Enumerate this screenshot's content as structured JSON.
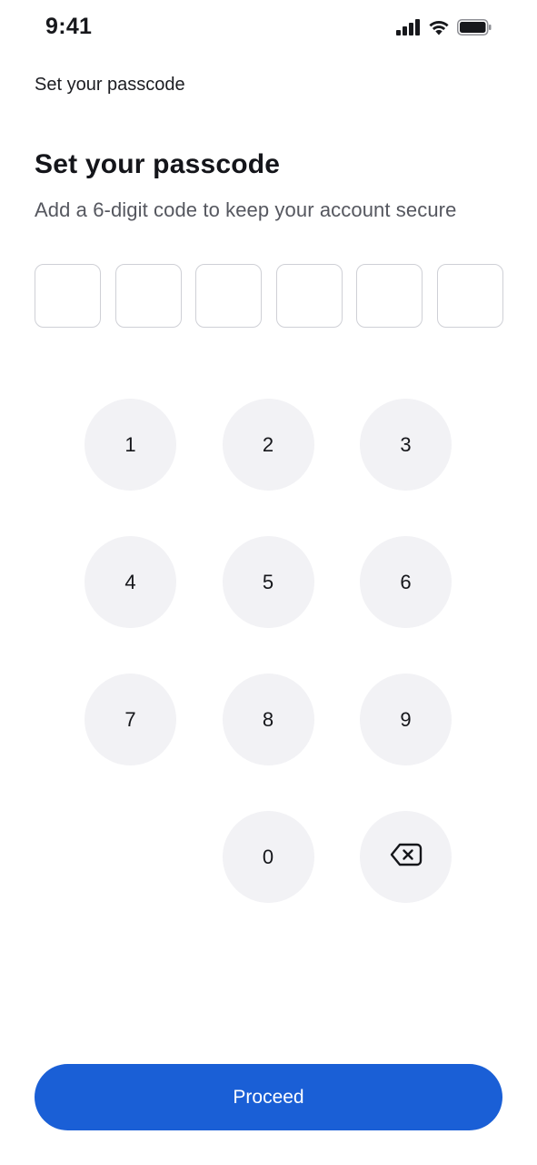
{
  "status_bar": {
    "time": "9:41",
    "icons": [
      "cellular-signal-icon",
      "wifi-icon",
      "battery-icon"
    ]
  },
  "nav": {
    "title": "Set your passcode"
  },
  "main": {
    "heading": "Set your passcode",
    "subtitle": "Add a 6-digit code to keep your account secure",
    "code_digits": [
      "",
      "",
      "",
      "",
      "",
      ""
    ]
  },
  "keypad": {
    "keys": [
      "1",
      "2",
      "3",
      "4",
      "5",
      "6",
      "7",
      "8",
      "9",
      "",
      "0",
      "backspace-icon"
    ]
  },
  "footer": {
    "proceed_label": "Proceed"
  },
  "colors": {
    "accent": "#1a5fd6",
    "key_background": "#f2f2f5",
    "box_border": "#cfd0d6",
    "subtitle_text": "#55575f"
  }
}
